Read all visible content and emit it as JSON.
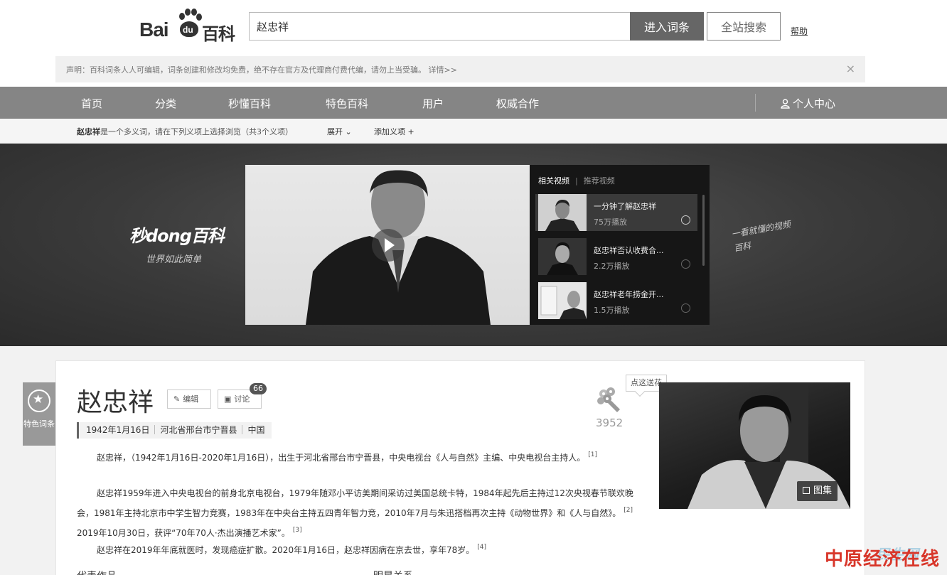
{
  "header": {
    "logo_text": "Bai",
    "logo_paw_text": "du",
    "logo_baike": "百科",
    "search_value": "赵忠祥",
    "enter_button": "进入词条",
    "site_search_button": "全站搜索",
    "help_link": "帮助"
  },
  "notice": {
    "text": "声明：百科词条人人可编辑，词条创建和修改均免费，绝不存在官方及代理商付费代编，请勿上当受骗。 详情>>",
    "close": "×"
  },
  "nav": {
    "items": [
      "首页",
      "分类",
      "秒懂百科",
      "特色百科",
      "用户",
      "权威合作"
    ],
    "user_center": "个人中心"
  },
  "polysemy": {
    "term": "赵忠祥",
    "text": "是一个多义词，请在下列义项上选择浏览（共3个义项）",
    "expand": "展开",
    "add": "添加义项"
  },
  "banner": {
    "brand": "秒dong百科",
    "slogan": "世界如此简单",
    "slogan_right": "一看就懂的视频百科",
    "tabs": {
      "related": "相关视频",
      "recommended": "推荐视频"
    },
    "videos": [
      {
        "title": "一分钟了解赵忠祥",
        "plays": "75万播放"
      },
      {
        "title": "赵忠祥否认收费合...",
        "plays": "2.2万播放"
      },
      {
        "title": "赵忠祥老年捞金开...",
        "plays": "1.5万播放"
      }
    ]
  },
  "entry": {
    "feature_badge": "特色词条",
    "title": "赵忠祥",
    "edit": "编辑",
    "discuss": "讨论",
    "discuss_count": "66",
    "facts": [
      "1942年1月16日",
      "河北省邢台市宁晋县",
      "中国"
    ],
    "flower_tip": "点这送花",
    "flower_count": "3952",
    "gallery": "图集",
    "paragraphs": [
      {
        "text": "赵忠祥，（1942年1月16日-2020年1月16日），出生于河北省邢台市宁晋县，中央电视台《人与自然》主编、中央电视台主持人。",
        "ref": "[1]"
      },
      {
        "text": "赵忠祥1959年进入中央电视台的前身北京电视台，1979年随邓小平访美期间采访过美国总统卡特，1984年起先后主持过12次央视春节联欢晚会，1981年主持北京市中学生智力竞赛，1983年在中央台主持五四青年智力竞，2010年7月与朱迅搭档再次主持《动物世界》和《人与自然》。",
        "ref": "[2]",
        "tail": "2019年10月30日，获评“70年70人·杰出演播艺术家”。",
        "ref2": "[3]"
      },
      {
        "text": "赵忠祥在2019年年底就医时，发现癌症扩散。2020年1月16日，赵忠祥因病在京去世，享年78岁。",
        "ref": "[4]"
      }
    ],
    "below_left": "代表作品",
    "below_right": "明星关系"
  },
  "watermark": {
    "text": "中原经济在线",
    "sub": "民生网"
  },
  "colors": {
    "nav_bg": "#858585",
    "button_dark": "#666666",
    "watermark": "#d8362a"
  }
}
